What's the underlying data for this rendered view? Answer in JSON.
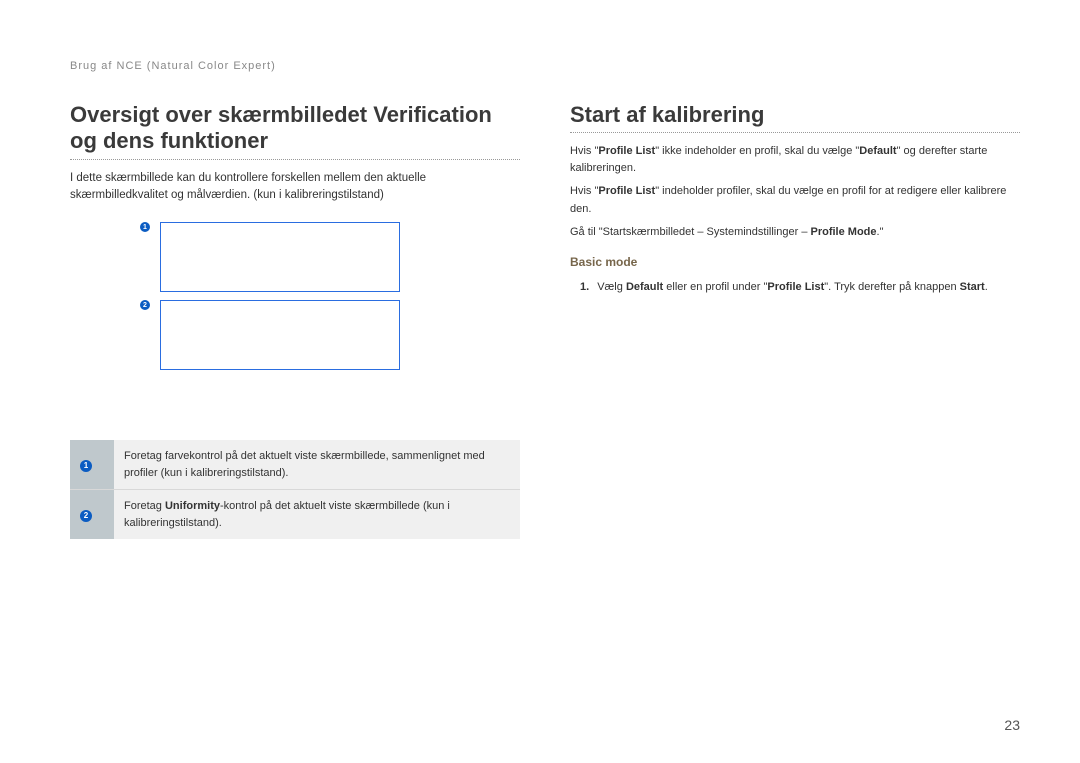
{
  "breadcrumb": "Brug af NCE (Natural Color Expert)",
  "left": {
    "title": "Oversigt over skærmbilledet Verification og dens funktioner",
    "intro": "I dette skærmbillede kan du kontrollere forskellen mellem den aktuelle skærmbilledkvalitet og målværdien. (kun i kalibreringstilstand)",
    "markers": {
      "m1": "1",
      "m2": "2"
    },
    "legend": {
      "n1": "1",
      "d1_a": "Foretag farvekontrol på det aktuelt viste skærmbillede, sammenlignet med profiler (kun i kalibreringstilstand).",
      "n2": "2",
      "d2_a": "Foretag ",
      "d2_b": "Uniformity",
      "d2_c": "-kontrol på det aktuelt viste skærmbillede (kun i kalibreringstilstand)."
    }
  },
  "right": {
    "title": "Start af kalibrering",
    "p1_a": "Hvis \"",
    "p1_b": "Profile List",
    "p1_c": "\" ikke indeholder en profil, skal du vælge \"",
    "p1_d": "Default",
    "p1_e": "\" og derefter starte kalibreringen.",
    "p2_a": "Hvis \"",
    "p2_b": "Profile List",
    "p2_c": "\" indeholder profiler, skal du vælge en profil for at redigere eller kalibrere den.",
    "p3_a": "Gå til \"Startskærmbilledet – Systemindstillinger – ",
    "p3_b": "Profile Mode",
    "p3_c": ".\"",
    "sub": "Basic mode",
    "step_num": "1.",
    "step_a": "Vælg ",
    "step_b": "Default",
    "step_c": " eller en profil under \"",
    "step_d": "Profile List",
    "step_e": "\". Tryk derefter på knappen ",
    "step_f": "Start",
    "step_g": "."
  },
  "page_number": "23"
}
